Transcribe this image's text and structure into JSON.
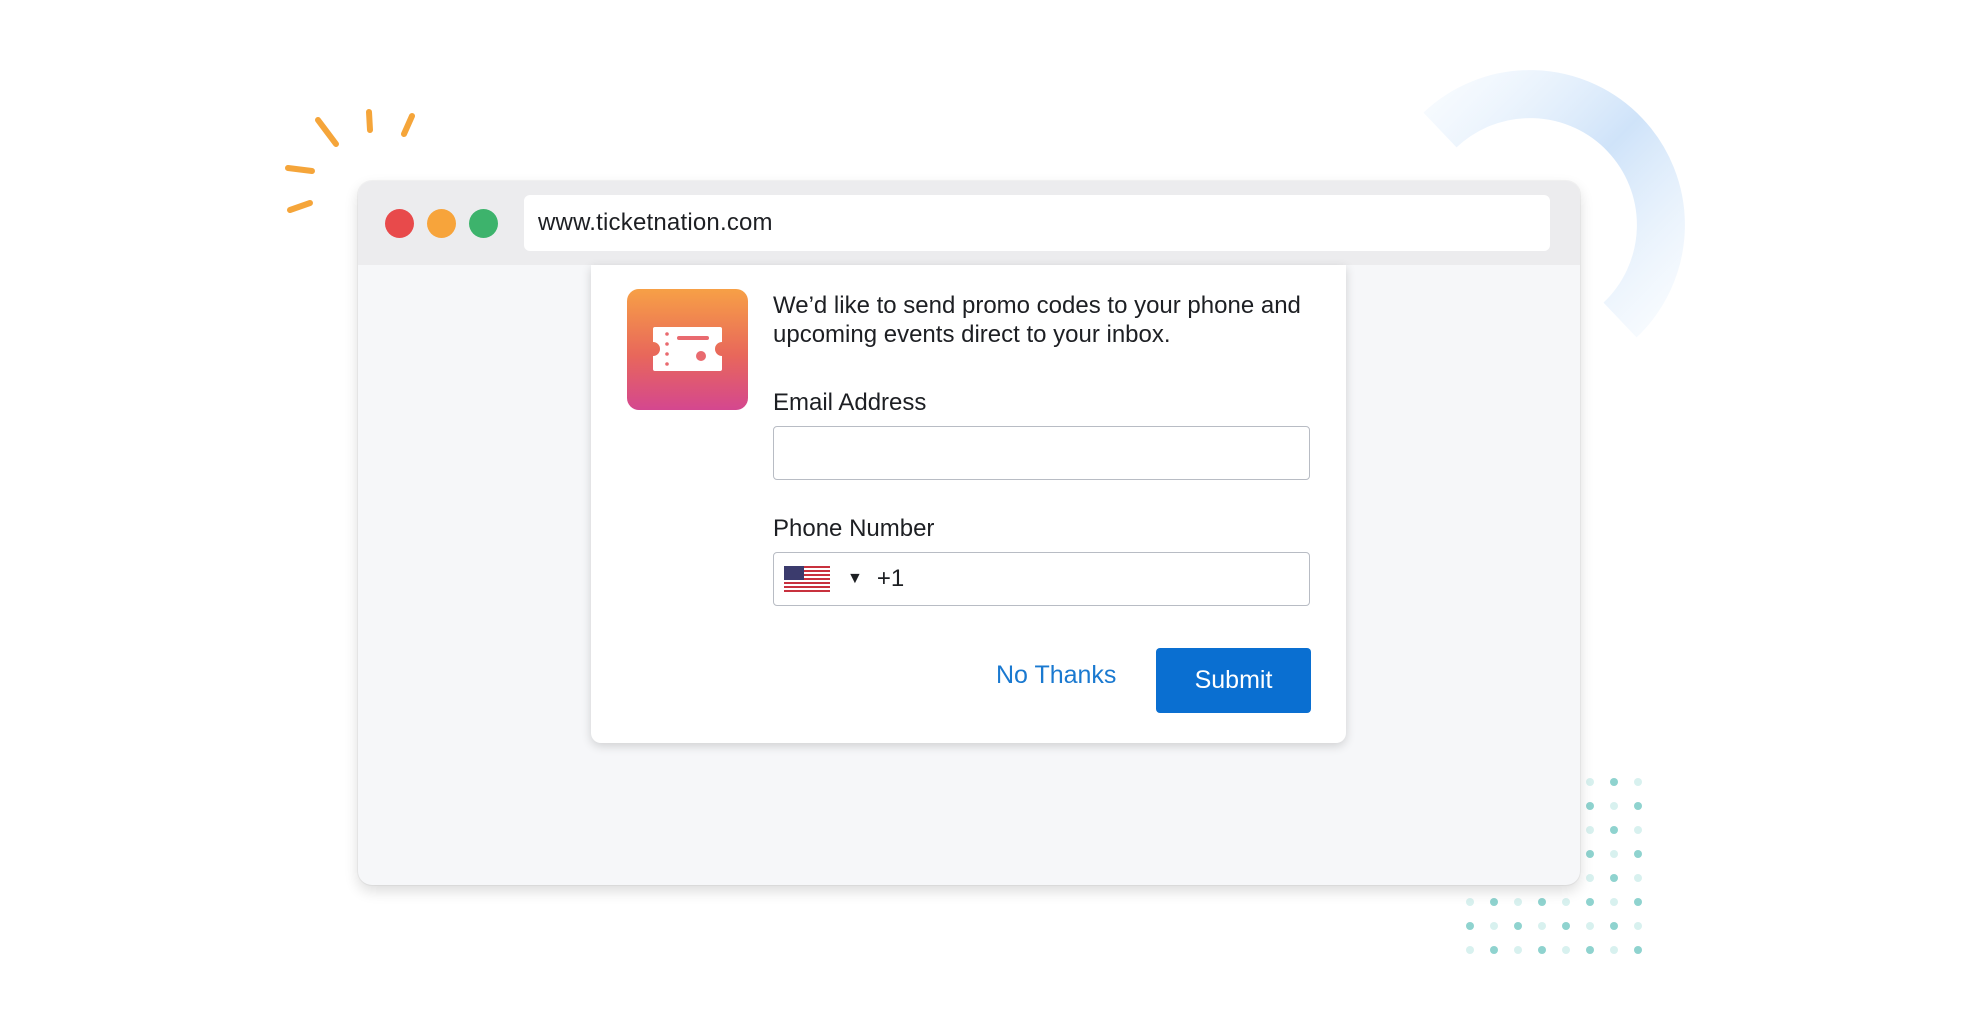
{
  "browser": {
    "url": "www.ticketnation.com"
  },
  "modal": {
    "icon": "ticket-icon",
    "intro_text": "We’d like to send promo codes to your phone and upcoming events direct to your inbox.",
    "email": {
      "label": "Email Address",
      "value": "",
      "placeholder": ""
    },
    "phone": {
      "label": "Phone Number",
      "country_flag": "us-flag-icon",
      "dial_code": "+1",
      "value": ""
    },
    "no_thanks_label": "No Thanks",
    "submit_label": "Submit"
  },
  "colors": {
    "accent": "#0a6fd1",
    "link": "#1a79d0",
    "traffic_red": "#e84a4b",
    "traffic_yellow": "#f7a43b",
    "traffic_green": "#3db36c"
  }
}
